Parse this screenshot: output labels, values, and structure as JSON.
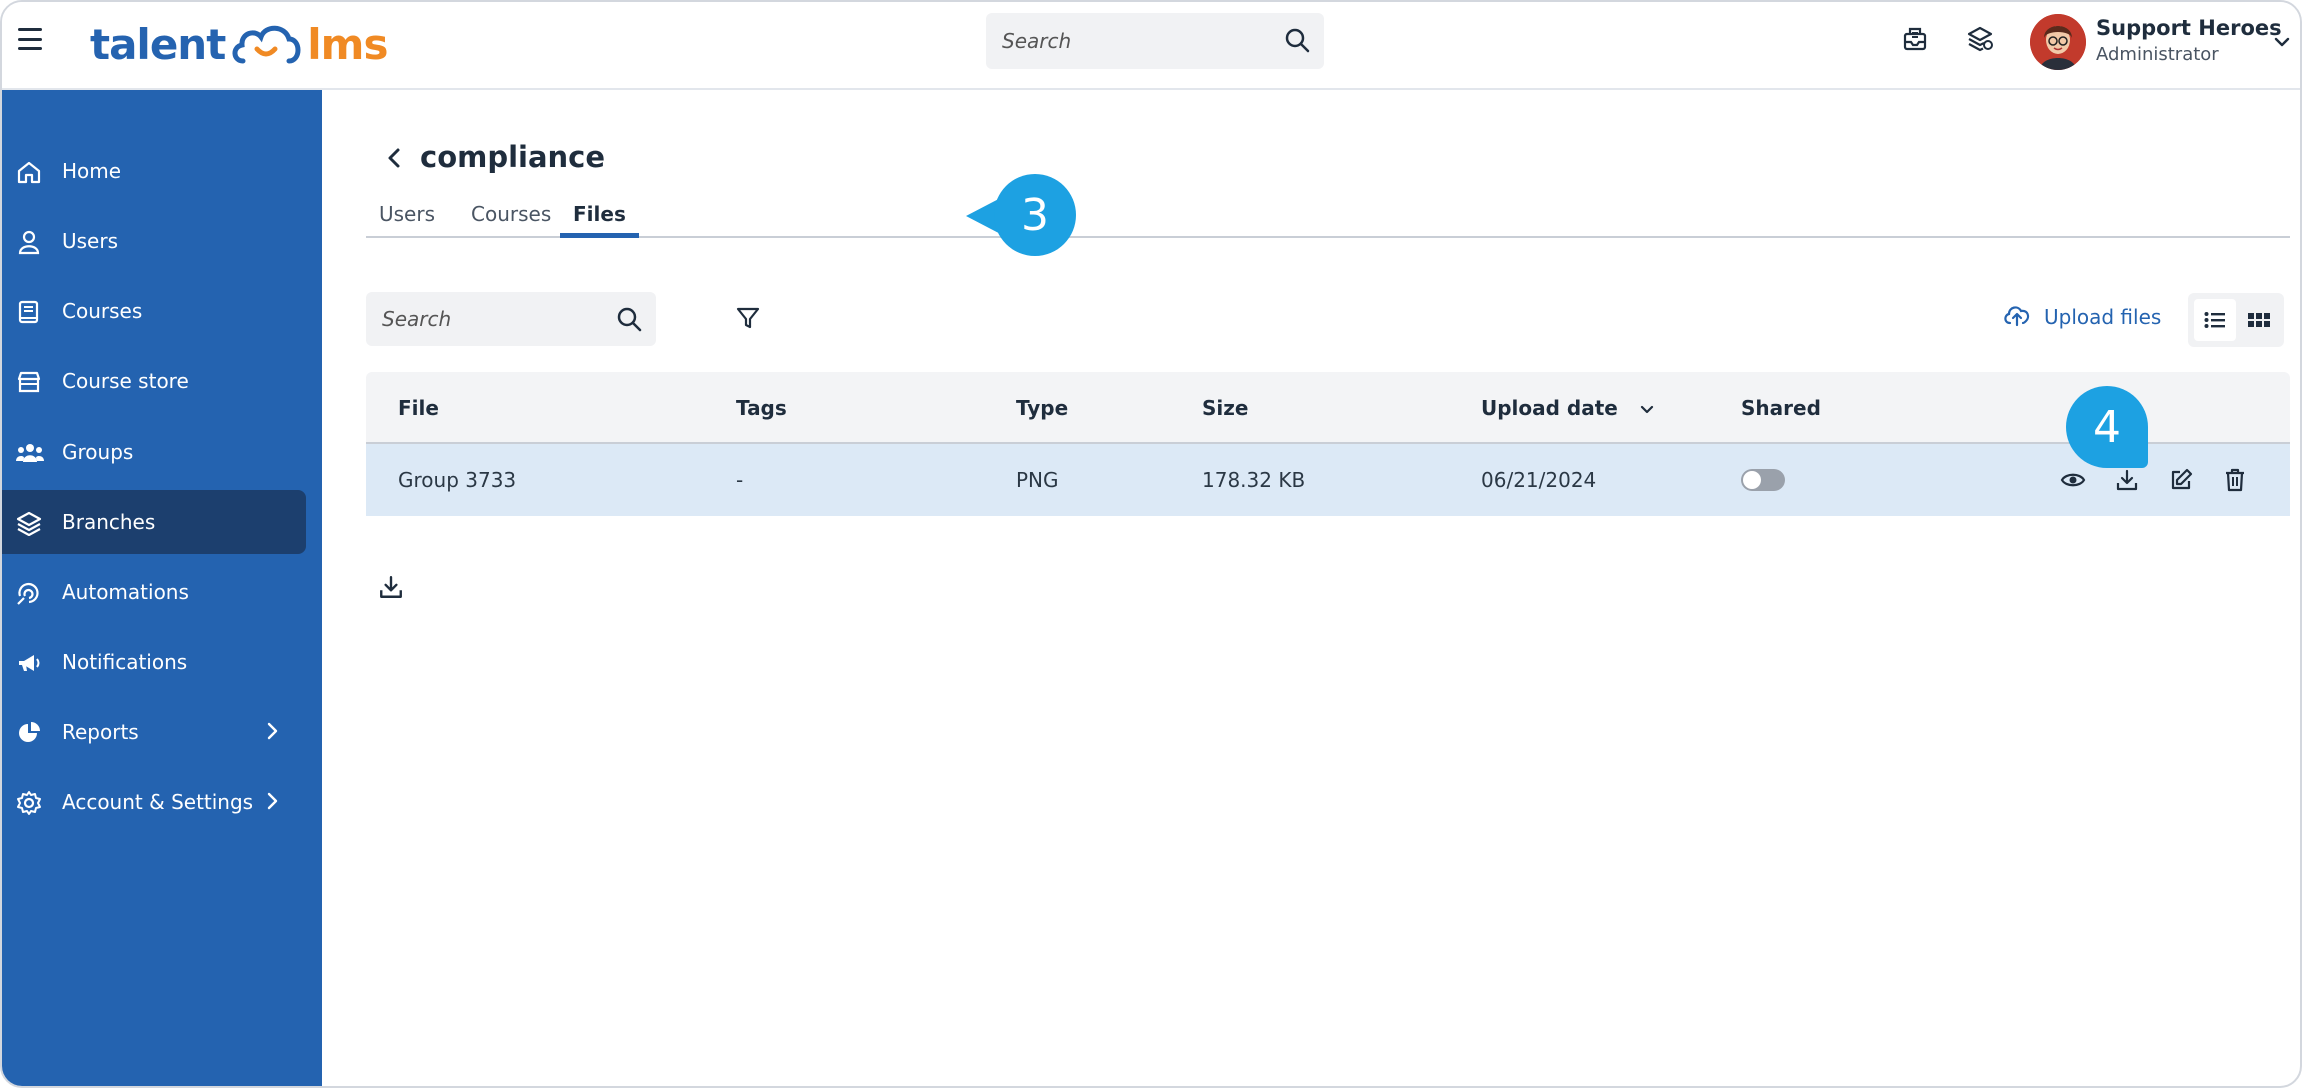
{
  "app": {
    "logo_left": "talent",
    "logo_right": "lms"
  },
  "top_search": {
    "placeholder": "Search"
  },
  "profile": {
    "name": "Support Heroes",
    "role": "Administrator"
  },
  "sidebar": {
    "items": [
      {
        "label": "Home",
        "icon": "home-icon"
      },
      {
        "label": "Users",
        "icon": "user-icon"
      },
      {
        "label": "Courses",
        "icon": "book-icon"
      },
      {
        "label": "Course store",
        "icon": "store-icon"
      },
      {
        "label": "Groups",
        "icon": "groups-icon"
      },
      {
        "label": "Branches",
        "icon": "layers-icon",
        "active": true
      },
      {
        "label": "Automations",
        "icon": "automation-icon"
      },
      {
        "label": "Notifications",
        "icon": "megaphone-icon"
      },
      {
        "label": "Reports",
        "icon": "pie-chart-icon",
        "has_submenu": true
      },
      {
        "label": "Account & Settings",
        "icon": "gear-icon",
        "has_submenu": true
      }
    ]
  },
  "page": {
    "title": "compliance",
    "tabs": [
      {
        "label": "Users"
      },
      {
        "label": "Courses"
      },
      {
        "label": "Files",
        "active": true
      }
    ],
    "callouts": {
      "tab_step": "3",
      "action_step": "4"
    }
  },
  "files": {
    "search_placeholder": "Search",
    "upload_label": "Upload files",
    "columns": {
      "file": "File",
      "tags": "Tags",
      "type": "Type",
      "size": "Size",
      "upload_date": "Upload date",
      "shared": "Shared"
    },
    "rows": [
      {
        "file": "Group 3733",
        "tags": "-",
        "type": "PNG",
        "size": "178.32 KB",
        "upload_date": "06/21/2024",
        "shared": false
      }
    ]
  },
  "colors": {
    "brand_blue": "#2463b0",
    "brand_orange": "#f08a24",
    "sidebar_active": "#1c3f6e",
    "callout": "#1da1e2",
    "row_selected": "#dce9f6"
  }
}
